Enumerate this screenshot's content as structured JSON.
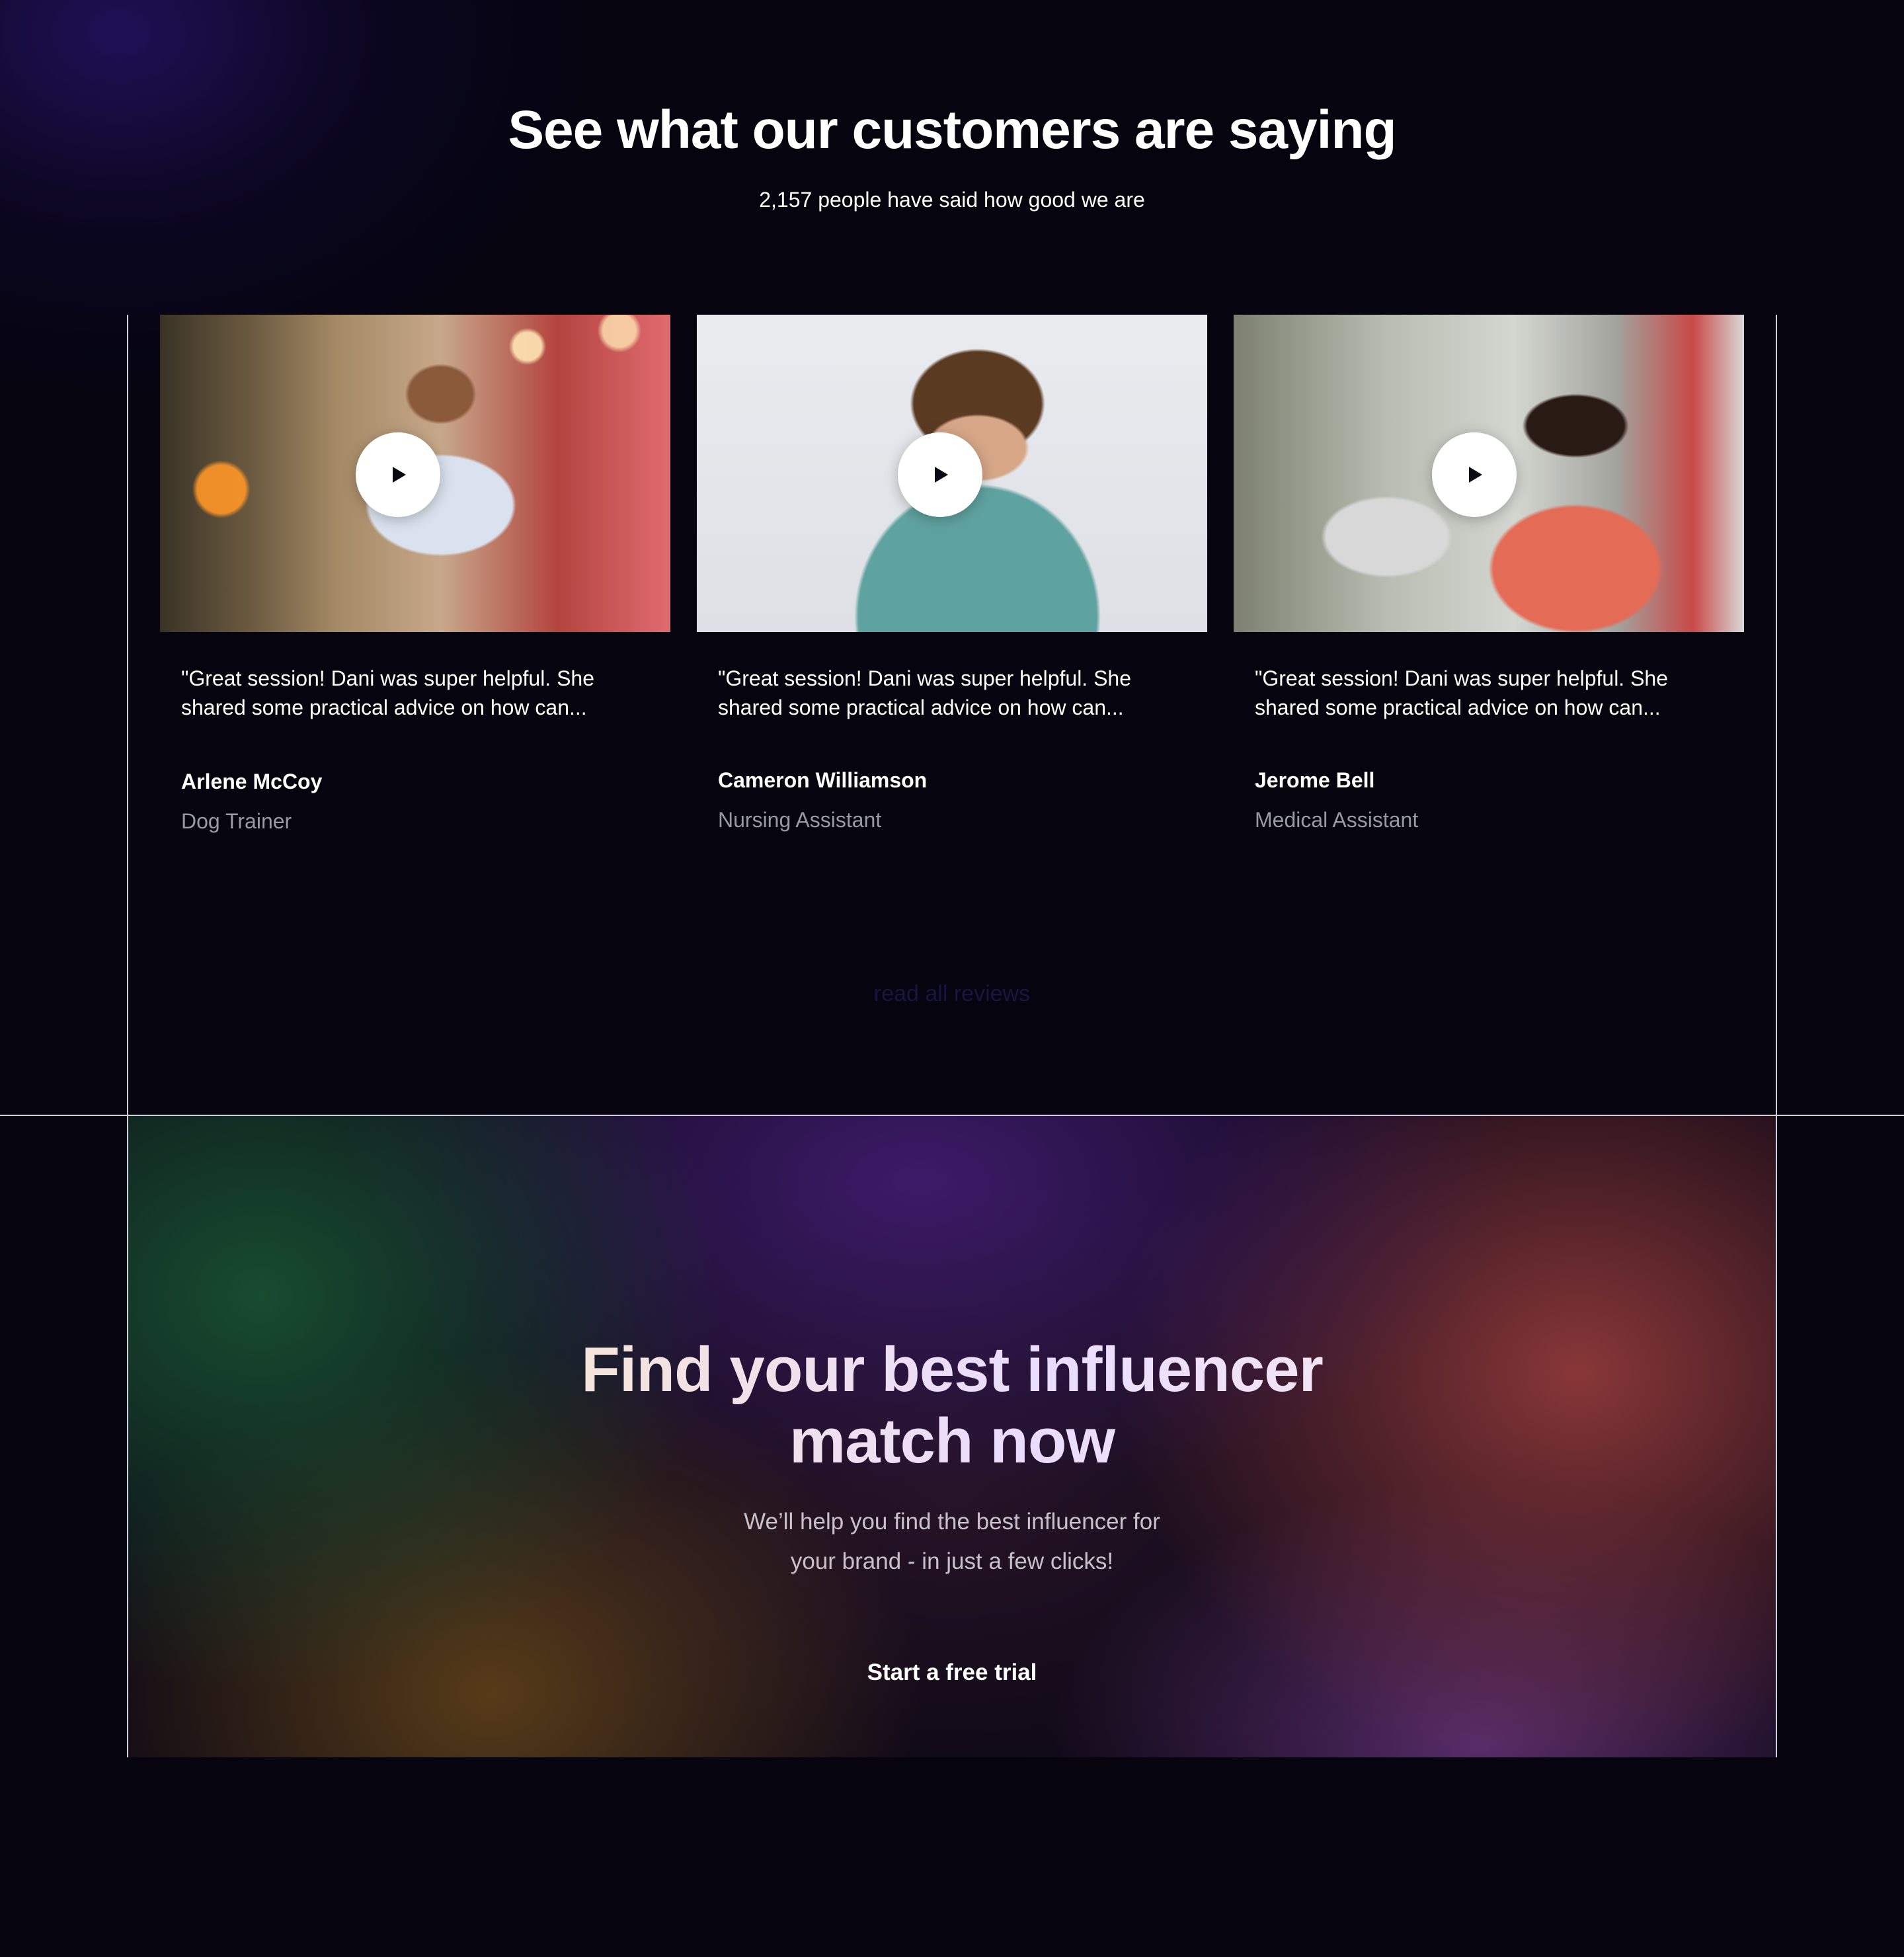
{
  "testimonials": {
    "title": "See what our customers are saying",
    "subtitle": "2,157 people have said how good we are",
    "cards": [
      {
        "quote": "\"Great session! Dani was super helpful. She shared some practical advice on how can...",
        "name": "Arlene McCoy",
        "role": "Dog Trainer"
      },
      {
        "quote": "\"Great session! Dani was super helpful. She shared some practical advice on how can...",
        "name": "Cameron Williamson",
        "role": "Nursing Assistant"
      },
      {
        "quote": "\"Great session! Dani was super helpful. She shared some practical advice on how can...",
        "name": "Jerome Bell",
        "role": "Medical Assistant"
      }
    ],
    "read_all_label": "read all reviews"
  },
  "cta": {
    "title_line1": "Find your best influencer",
    "title_line2": "match now",
    "subtitle_line1": "We’ll help you find the best influencer for",
    "subtitle_line2": "your brand - in just a few clicks!",
    "button_label": "Start a free trial"
  },
  "icons": {
    "play": "play-icon"
  },
  "colors": {
    "background": "#05040f",
    "text": "#ffffff",
    "muted_text": "#9a9aa6",
    "divider": "#cfcfe0"
  }
}
